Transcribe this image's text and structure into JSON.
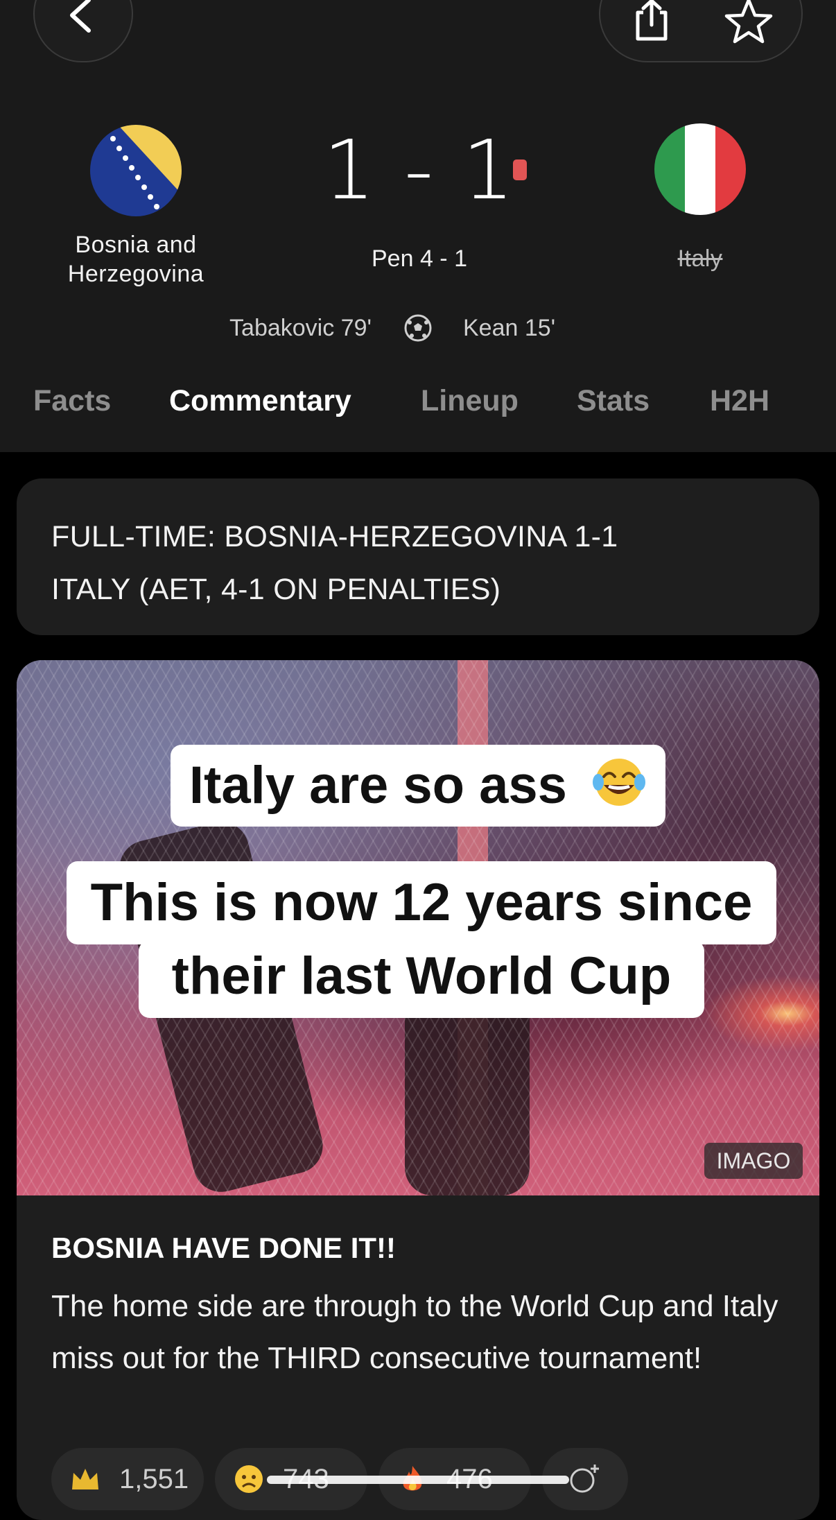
{
  "match": {
    "home_team": "Bosnia and Herzegovina",
    "away_team": "Italy",
    "score": "1 - 1",
    "penalties": "Pen  4 - 1",
    "home_scorer": "Tabakovic 79'",
    "away_scorer": "Kean 15'"
  },
  "tabs": [
    {
      "label": "Facts",
      "active": false
    },
    {
      "label": "Commentary",
      "active": true
    },
    {
      "label": "Lineup",
      "active": false
    },
    {
      "label": "Stats",
      "active": false
    },
    {
      "label": "H2H",
      "active": false
    }
  ],
  "fulltime": {
    "line1": "FULL-TIME: BOSNIA-HERZEGOVINA 1-1",
    "line2": "ITALY (AET, 4-1 ON PENALTIES)"
  },
  "post": {
    "caption1": "Italy are so ass",
    "caption2_line1": "This is now 12 years since",
    "caption2_line2": "their last World Cup",
    "photo_credit": "IMAGO",
    "title": "BOSNIA HAVE DONE IT!!",
    "body": "The home side are through to the World Cup and Italy miss out for the THIRD consecutive tournament!",
    "reactions": [
      {
        "icon": "crown-icon",
        "count": "1,551"
      },
      {
        "icon": "sad-face-icon",
        "count": "743"
      },
      {
        "icon": "fire-icon",
        "count": "476"
      }
    ]
  },
  "colors": {
    "background": "#000000",
    "header": "#1a1a1a",
    "card": "#1e1e1e",
    "red_card": "#e25555",
    "tab_inactive": "#8e8e8e"
  }
}
